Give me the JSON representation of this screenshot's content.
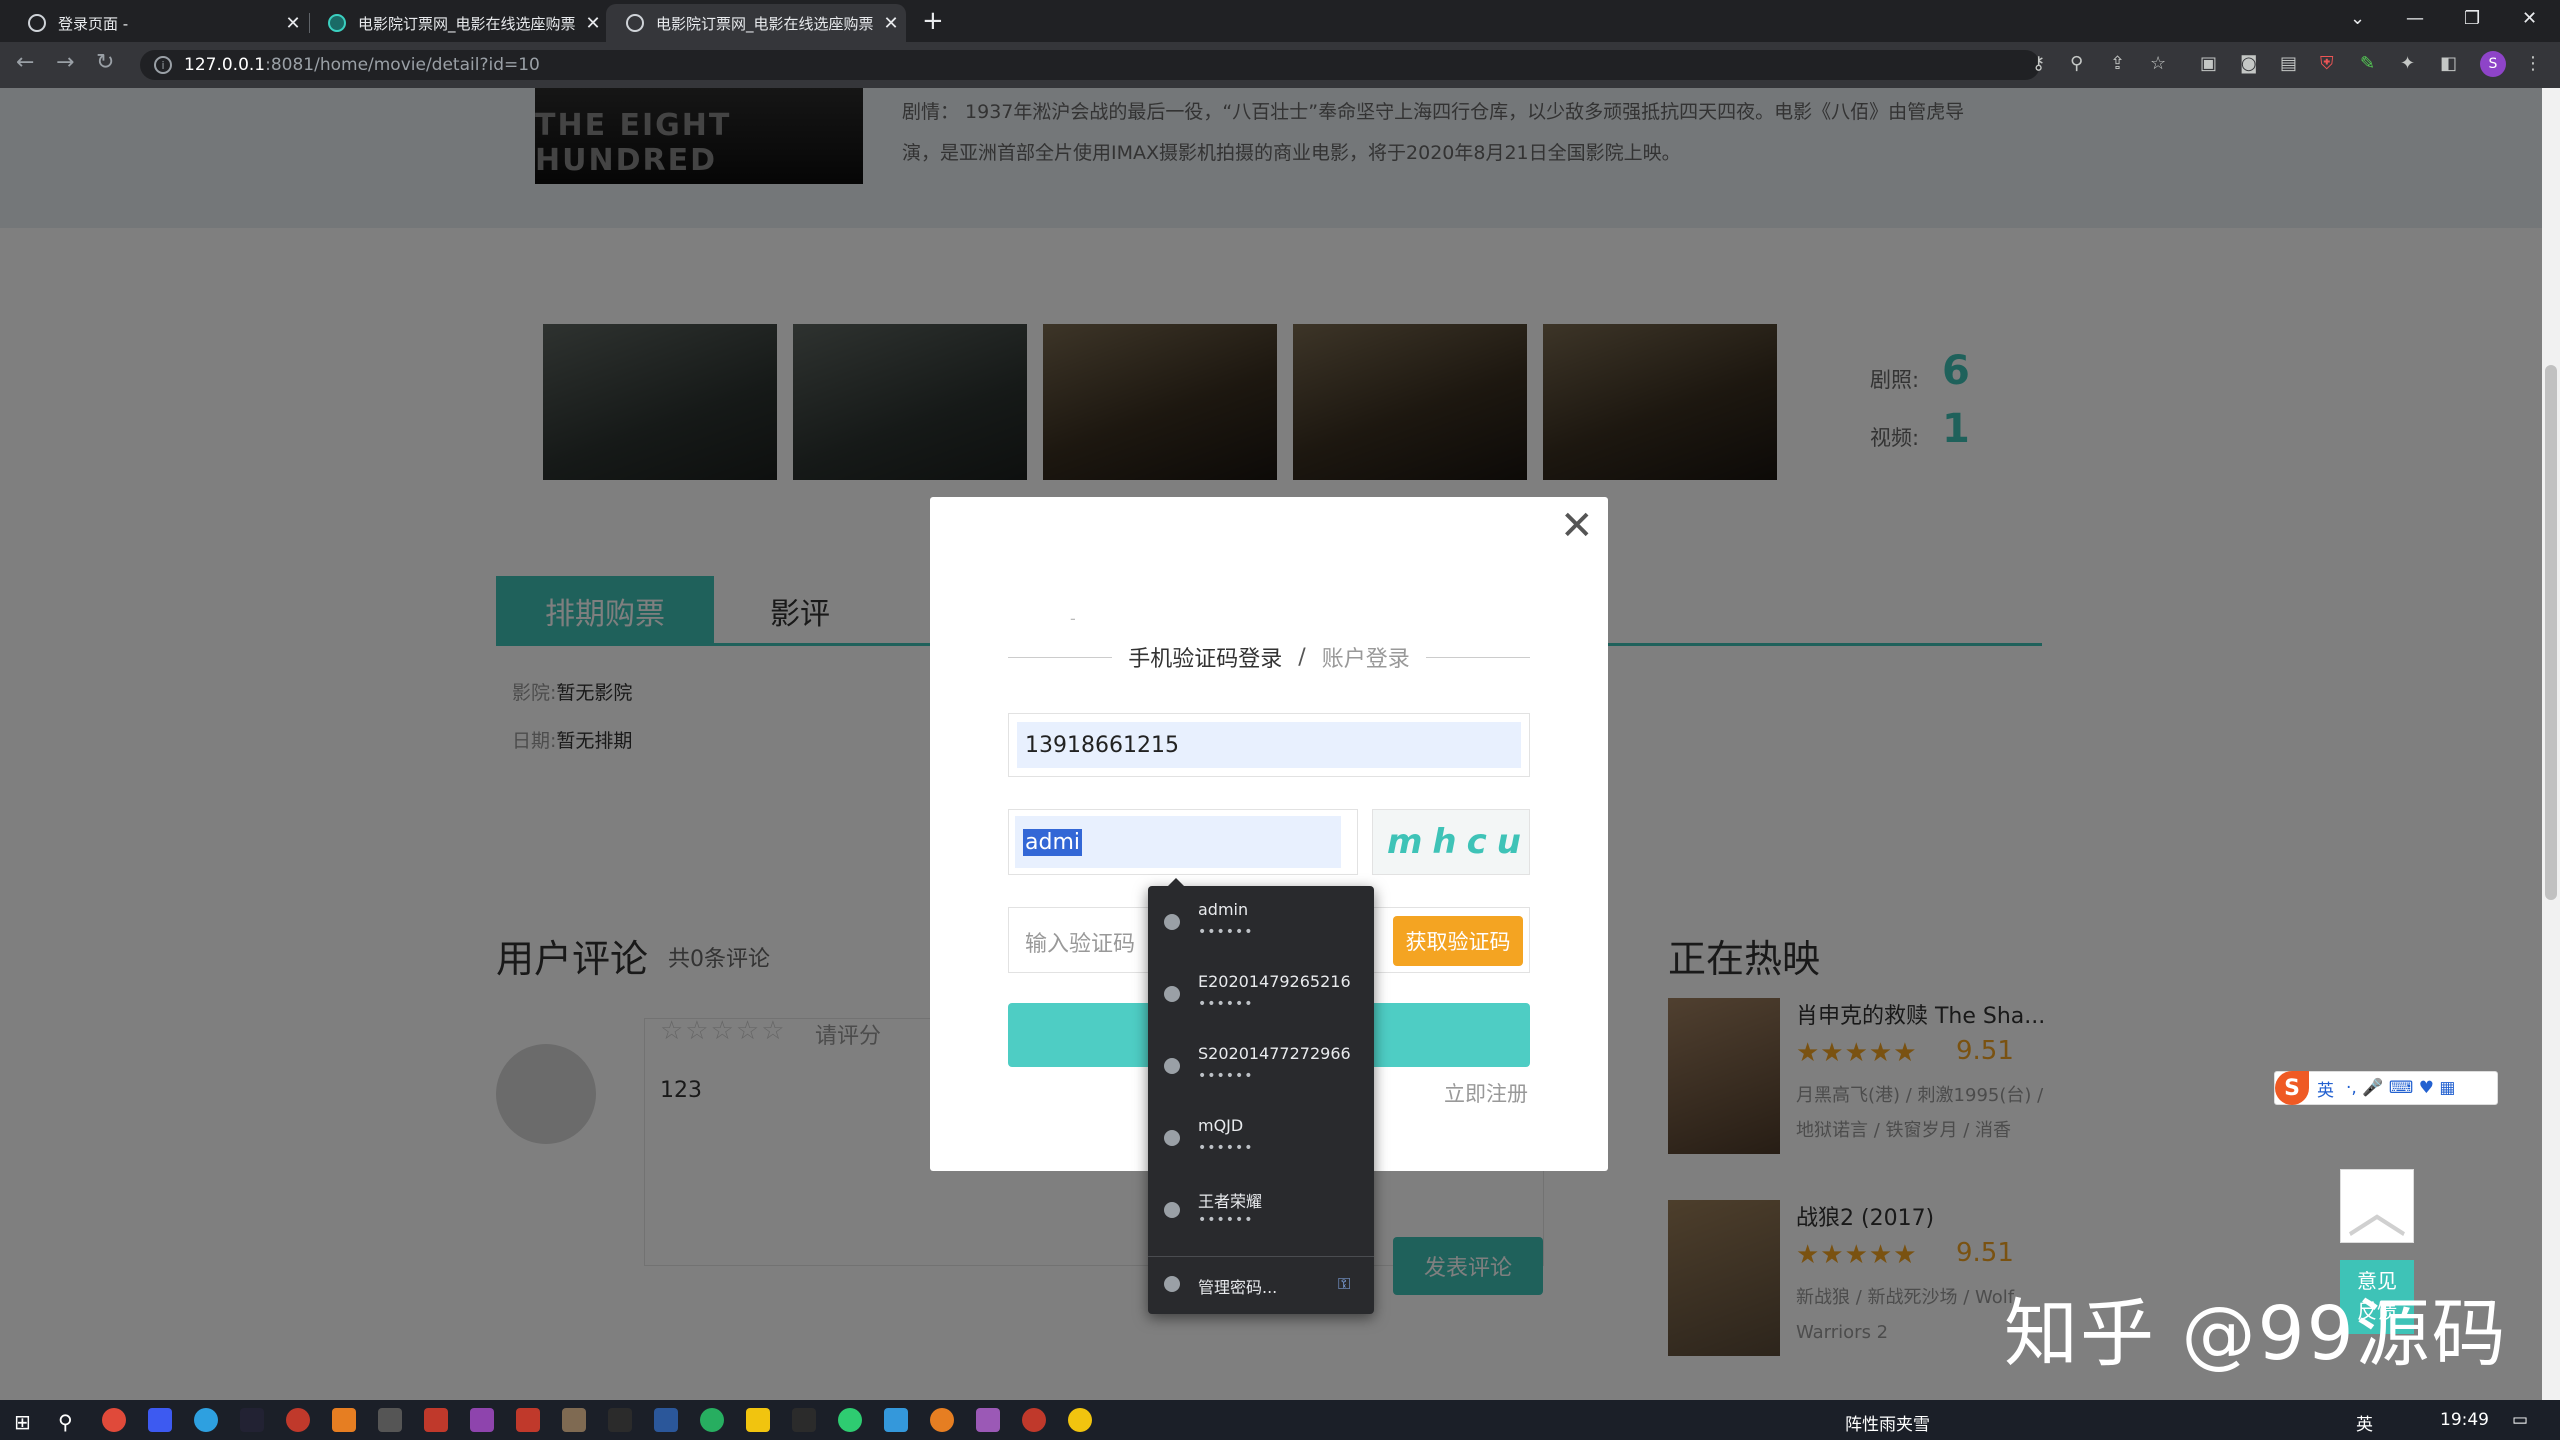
{
  "browser": {
    "tabs": [
      {
        "title": "登录页面 -",
        "close": "✕"
      },
      {
        "title": "电影院订票网_电影在线选座购票",
        "close": "✕"
      },
      {
        "title": "电影院订票网_电影在线选座购票",
        "close": "✕"
      }
    ],
    "new_tab": "+",
    "url_host": "127.0.0.1",
    "url_path": ":8081/home/movie/detail?id=10",
    "profile_initial": "S",
    "window_controls": {
      "minimize": "—",
      "maximize": "❐",
      "close": "✕",
      "tab_search": "⌄"
    }
  },
  "movie": {
    "poster_text": "THE EIGHT HUNDRED",
    "synopsis": "剧情： 1937年淞沪会战的最后一役，“八百壮士”奉命坚守上海四行仓库，以少敌多顽强抵抗四天四夜。电影《八佰》由管虎导演，是亚洲首部全片使用IMAX摄影机拍摄的商业电影，将于2020年8月21日全国影院上映。",
    "stills_label": "剧照:",
    "stills_count": "6",
    "video_label": "视频:",
    "video_count": "1"
  },
  "detail_tabs": {
    "buy": "排期购票",
    "review": "影评"
  },
  "schedule": {
    "cinema_key": "影院:",
    "cinema_val": "暂无影院",
    "date_key": "日期:",
    "date_val": "暂无排期"
  },
  "comments": {
    "title": "用户评论",
    "count": "共0条评论",
    "stars": "☆☆☆☆☆",
    "rate_label": "请评分",
    "text": "123",
    "submit": "发表评论"
  },
  "hot": {
    "title": "正在热映",
    "items": [
      {
        "name": "肖申克的救赎 The Sha...",
        "stars": "★★★★★",
        "score": "9.51",
        "desc": "月黑高飞(港) / 刺激1995(台) / 地狱诺言 / 铁窗岁月 / 消香"
      },
      {
        "name": "战狼2 (2017)",
        "stars": "★★★★★",
        "score": "9.51",
        "desc": "新战狼 / 新战死沙场 / Wolf Warriors 2"
      }
    ]
  },
  "side": {
    "ime": "英",
    "backtop": "︿",
    "feedback_line1": "意见",
    "feedback_line2": "反馈"
  },
  "watermark": "知乎 @99源码",
  "modal": {
    "close": "✕",
    "dash": "-",
    "tab_sms": "手机验证码登录",
    "slash": "/",
    "tab_account": "账户登录",
    "phone_value": "13918661215",
    "captcha_input_value": "admi",
    "captcha_image_text": "mhcu",
    "code_placeholder": "输入验证码",
    "get_code": "获取验证码",
    "register": "立即注册"
  },
  "autofill": {
    "items": [
      {
        "name": "admin",
        "pw": "••••••"
      },
      {
        "name": "E20201479265216",
        "pw": "••••••"
      },
      {
        "name": "S20201477272966",
        "pw": "••••••"
      },
      {
        "name": "mQJD",
        "pw": "••••••"
      },
      {
        "name": "王者荣耀",
        "pw": "••••••"
      }
    ],
    "manage": "管理密码...",
    "key_icon": "⚿"
  },
  "taskbar": {
    "weather": "阵性雨夹雪",
    "lang": "英",
    "time": "19:49"
  },
  "colors": {
    "accent": "#3ec3b7",
    "orange": "#f4a422",
    "chrome_dark": "#202124"
  }
}
